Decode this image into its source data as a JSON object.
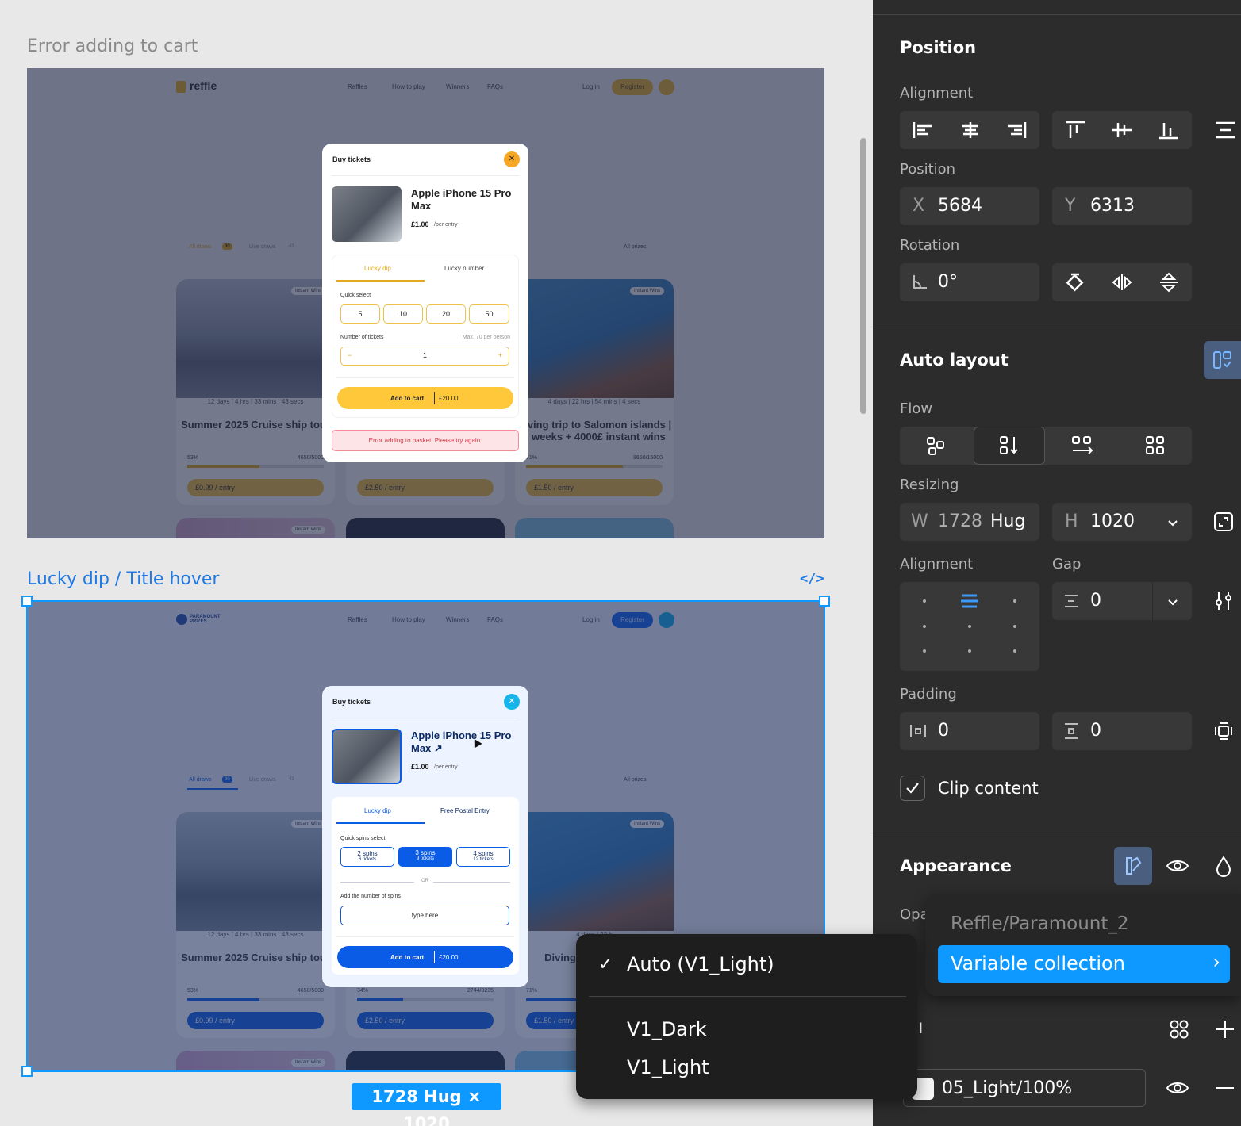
{
  "canvas": {
    "frame1_title": "Error adding to cart",
    "frame2_title": "Lucky dip / Title hover",
    "size_badge": "1728 Hug × 1020"
  },
  "frame1": {
    "logo": "reffle",
    "nav": [
      "Raffles",
      "How to play",
      "Winners",
      "FAQs"
    ],
    "login": "Log in",
    "register": "Register",
    "tabs": [
      "All draws",
      "30",
      "Live draws",
      "43"
    ],
    "all_prizes": "All prizes",
    "card1": {
      "badge": "Instant Wins",
      "timer": [
        "12 days",
        "4 hrs",
        "33 mins",
        "43 secs"
      ],
      "title": "Summer 2025 Cruise ship tour",
      "pct": "53%",
      "count": "4650/5000",
      "price": "£0.99 / entry"
    },
    "card2": {
      "price": "£2.50 / entry"
    },
    "card3": {
      "badge": "Instant Wins",
      "timer": [
        "4 days",
        "22 hrs",
        "54 mins",
        "4 secs"
      ],
      "title": "Diving trip to Salomon islands | 2 weeks + 4000£ instant wins",
      "pct": "71%",
      "count": "8650/15000",
      "price": "£1.50 / entry"
    },
    "card4": {
      "badge": "Instant Wins"
    },
    "modal": {
      "title": "Buy tickets",
      "product": "Apple iPhone 15 Pro Max",
      "price": "£1.00",
      "per": "/per entry",
      "tab1": "Lucky dip",
      "tab2": "Lucky number",
      "quick": "Quick select",
      "options": [
        "5",
        "10",
        "20",
        "50"
      ],
      "num_label": "Number of tickets",
      "max": "Max. 70 per person",
      "minus": "−",
      "qty": "1",
      "plus": "+",
      "add": "Add to cart",
      "total": "£20.00",
      "error": "Error adding to basket. Please try again."
    }
  },
  "frame2": {
    "logo": "PARAMOUNT PRIZES",
    "nav": [
      "Raffles",
      "How to play",
      "Winners",
      "FAQs"
    ],
    "login": "Log in",
    "register": "Register",
    "tabs": [
      "All draws",
      "30",
      "Live draws",
      "43"
    ],
    "all_prizes": "All prizes",
    "card1": {
      "badge": "Instant Wins",
      "timer": [
        "12 days",
        "4 hrs",
        "33 mins",
        "43 secs"
      ],
      "title": "Summer 2025 Cruise ship tour",
      "pct": "53%",
      "count": "4650/5000",
      "price": "£0.99 / entry"
    },
    "card2": {
      "pct": "34%",
      "count": "2744/8235",
      "price": "£2.50 / entry"
    },
    "card3": {
      "badge": "Instant Wins",
      "timer": [
        "4 days",
        "22 h"
      ],
      "title": "Diving t islands | ins",
      "pct": "71%",
      "price": "£1.50 / entry"
    },
    "card4": {
      "badge": "Instant Wins"
    },
    "modal": {
      "title": "Buy tickets",
      "product": "Apple iPhone 15 Pro Max",
      "arrow": "↗",
      "price": "£1.00",
      "per": "/per entry",
      "tab1": "Lucky dip",
      "tab2": "Free Postal Entry",
      "quick": "Quick spins select",
      "spins": [
        {
          "label": "2 spins",
          "sub": "6 tickets",
          "selected": false
        },
        {
          "label": "3 spins",
          "sub": "9 tickets",
          "selected": true
        },
        {
          "label": "4 spins",
          "sub": "12 tickets",
          "selected": false
        }
      ],
      "or": "OR",
      "add_label": "Add the number of spins",
      "placeholder": "type here",
      "add": "Add to cart",
      "total": "£20.00"
    }
  },
  "panel": {
    "position_title": "Position",
    "alignment_label": "Alignment",
    "position_label": "Position",
    "x_label": "X",
    "x": "5684",
    "y_label": "Y",
    "y": "6313",
    "rotation_label": "Rotation",
    "rotation": "0°",
    "auto_layout_title": "Auto layout",
    "flow_label": "Flow",
    "resizing_label": "Resizing",
    "w_label": "W",
    "w": "1728",
    "w_mode": "Hug",
    "h_label": "H",
    "h": "1020",
    "align_label": "Alignment",
    "gap_label": "Gap",
    "gap": "0",
    "padding_label": "Padding",
    "pad_h": "0",
    "pad_v": "0",
    "clip": "Clip content",
    "appearance_title": "Appearance",
    "opacity_label_partial": "Opa",
    "fill_label_partial": "l",
    "fill_value": "05_Light/100%"
  },
  "mode_menu": {
    "items": [
      "Auto (V1_Light)",
      "V1_Dark",
      "V1_Light"
    ],
    "checked": 0
  },
  "collection_menu": {
    "header": "Reffle/Paramount_2",
    "item": "Variable collection",
    "chevron": "›"
  },
  "colors": {
    "selection_blue": "#0d99ff",
    "reffle_yellow": "#ffc83a",
    "paramount_blue": "#0a5ce6",
    "panel_bg": "#2c2c2c"
  }
}
